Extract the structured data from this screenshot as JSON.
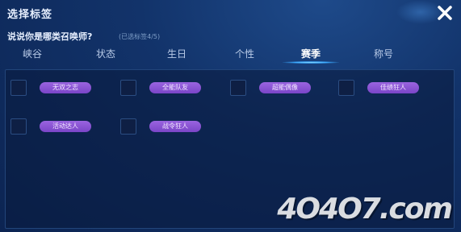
{
  "header": {
    "title": "选择标签"
  },
  "question": {
    "text": "说说你是哪类召唤师?",
    "count": "(已选标签4/5)"
  },
  "tabs": [
    {
      "label": "峡谷"
    },
    {
      "label": "状态"
    },
    {
      "label": "生日"
    },
    {
      "label": "个性"
    },
    {
      "label": "赛季"
    },
    {
      "label": "称号"
    }
  ],
  "active_tab": "赛季",
  "tags": [
    {
      "label": "无双之志"
    },
    {
      "label": "全能队友"
    },
    {
      "label": "超能偶像"
    },
    {
      "label": "佳绩狂人"
    },
    {
      "label": "活动达人"
    },
    {
      "label": "战令狂人"
    }
  ],
  "watermark": {
    "text": "4O4O7.com"
  },
  "colors": {
    "tag_bg": "#8a55d6",
    "active_underline": "#3aa8ff"
  }
}
